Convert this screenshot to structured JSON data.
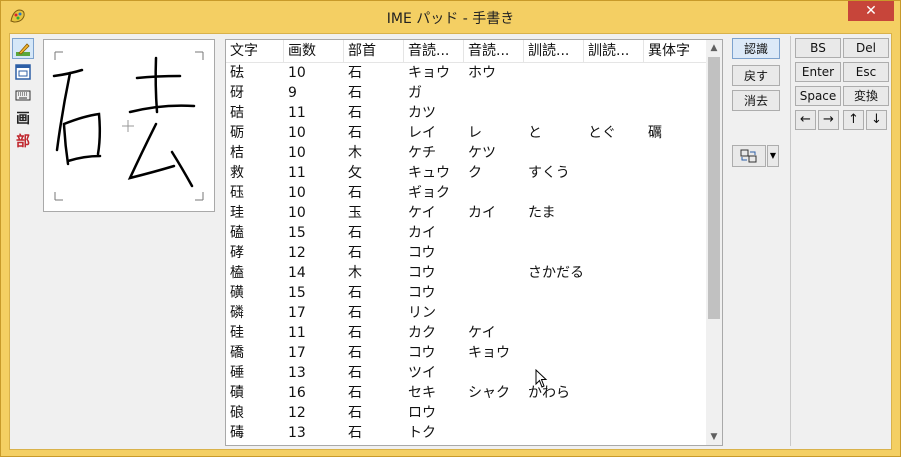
{
  "window": {
    "title": "IME パッド - 手書き",
    "close_glyph": "✕"
  },
  "toolbar": {
    "items": [
      {
        "name": "handwriting",
        "glyph": "✍",
        "active": true
      },
      {
        "name": "soft-keyboard",
        "glyph": "⌨",
        "active": false
      },
      {
        "name": "character-list",
        "glyph": "▦",
        "active": false
      },
      {
        "name": "stroke-count",
        "glyph": "画",
        "active": false
      },
      {
        "name": "radical",
        "glyph": "部",
        "active": false
      }
    ]
  },
  "list": {
    "headers": [
      "文字",
      "画数",
      "部首",
      "音読...",
      "音読...",
      "訓読...",
      "訓読...",
      "異体字"
    ],
    "rows": [
      [
        "砝",
        "10",
        "石",
        "キョウ",
        "ホウ",
        "",
        "",
        ""
      ],
      [
        "砑",
        "9",
        "石",
        "ガ",
        "",
        "",
        "",
        ""
      ],
      [
        "硈",
        "11",
        "石",
        "カツ",
        "",
        "",
        "",
        ""
      ],
      [
        "砺",
        "10",
        "石",
        "レイ",
        "レ",
        "と",
        "とぐ",
        "礪"
      ],
      [
        "桔",
        "10",
        "木",
        "ケチ",
        "ケツ",
        "",
        "",
        ""
      ],
      [
        "救",
        "11",
        "攵",
        "キュウ",
        "ク",
        "すくう",
        "",
        ""
      ],
      [
        "砡",
        "10",
        "石",
        "ギョク",
        "",
        "",
        "",
        ""
      ],
      [
        "珪",
        "10",
        "玉",
        "ケイ",
        "カイ",
        "たま",
        "",
        ""
      ],
      [
        "磕",
        "15",
        "石",
        "カイ",
        "",
        "",
        "",
        ""
      ],
      [
        "硣",
        "12",
        "石",
        "コウ",
        "",
        "",
        "",
        ""
      ],
      [
        "榼",
        "14",
        "木",
        "コウ",
        "",
        "さかだる",
        "",
        ""
      ],
      [
        "磺",
        "15",
        "石",
        "コウ",
        "",
        "",
        "",
        ""
      ],
      [
        "磷",
        "17",
        "石",
        "リン",
        "",
        "",
        "",
        ""
      ],
      [
        "硅",
        "11",
        "石",
        "カク",
        "ケイ",
        "",
        "",
        ""
      ],
      [
        "礄",
        "17",
        "石",
        "コウ",
        "キョウ",
        "",
        "",
        ""
      ],
      [
        "硾",
        "13",
        "石",
        "ツイ",
        "",
        "",
        "",
        ""
      ],
      [
        "磧",
        "16",
        "石",
        "セキ",
        "シャク",
        "かわら",
        "",
        ""
      ],
      [
        "硠",
        "12",
        "石",
        "ロウ",
        "",
        "",
        "",
        ""
      ],
      [
        "碡",
        "13",
        "石",
        "トク",
        "",
        "",
        "",
        ""
      ]
    ]
  },
  "commands": {
    "recognize": "認識",
    "undo": "戻す",
    "clear": "消去"
  },
  "keys": {
    "bs": "BS",
    "del": "Del",
    "enter": "Enter",
    "esc": "Esc",
    "space": "Space",
    "convert": "変換",
    "left": "←",
    "right": "→",
    "up": "↑",
    "down": "↓"
  },
  "colors": {
    "title_bar": "#f4cf63",
    "close": "#c7453a",
    "accent": "#7da2ce"
  }
}
